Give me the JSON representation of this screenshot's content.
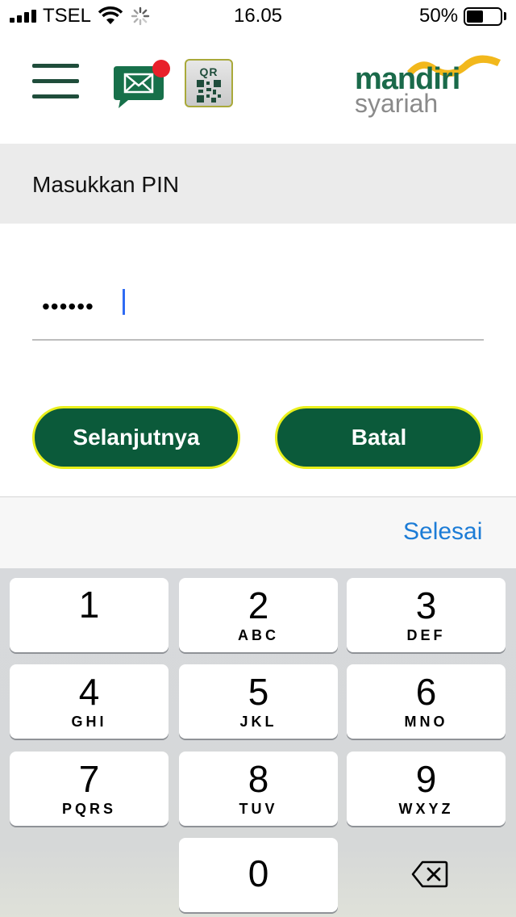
{
  "status_bar": {
    "carrier": "TSEL",
    "time": "16.05",
    "battery_percent": "50%",
    "battery_level": 0.5,
    "signal_bars": 3
  },
  "header": {
    "menu_icon": "hamburger-menu-icon",
    "mail_icon": "mail-icon",
    "qr_label": "QR",
    "logo": {
      "line1": "mandiri",
      "line2": "syariah",
      "accent": "#f2b81c",
      "primary": "#1a6a4a"
    }
  },
  "pin_section": {
    "title": "Masukkan PIN",
    "masked_value": "••••••"
  },
  "buttons": {
    "next_label": "Selanjutnya",
    "cancel_label": "Batal",
    "color": "#0b5a3a",
    "border_color": "#e9ef1b"
  },
  "keyboard": {
    "done_label": "Selesai",
    "keys": [
      {
        "num": "1",
        "letters": ""
      },
      {
        "num": "2",
        "letters": "ABC"
      },
      {
        "num": "3",
        "letters": "DEF"
      },
      {
        "num": "4",
        "letters": "GHI"
      },
      {
        "num": "5",
        "letters": "JKL"
      },
      {
        "num": "6",
        "letters": "MNO"
      },
      {
        "num": "7",
        "letters": "PQRS"
      },
      {
        "num": "8",
        "letters": "TUV"
      },
      {
        "num": "9",
        "letters": "WXYZ"
      },
      {
        "num": "0",
        "letters": ""
      }
    ],
    "delete_icon": "backspace-icon"
  }
}
